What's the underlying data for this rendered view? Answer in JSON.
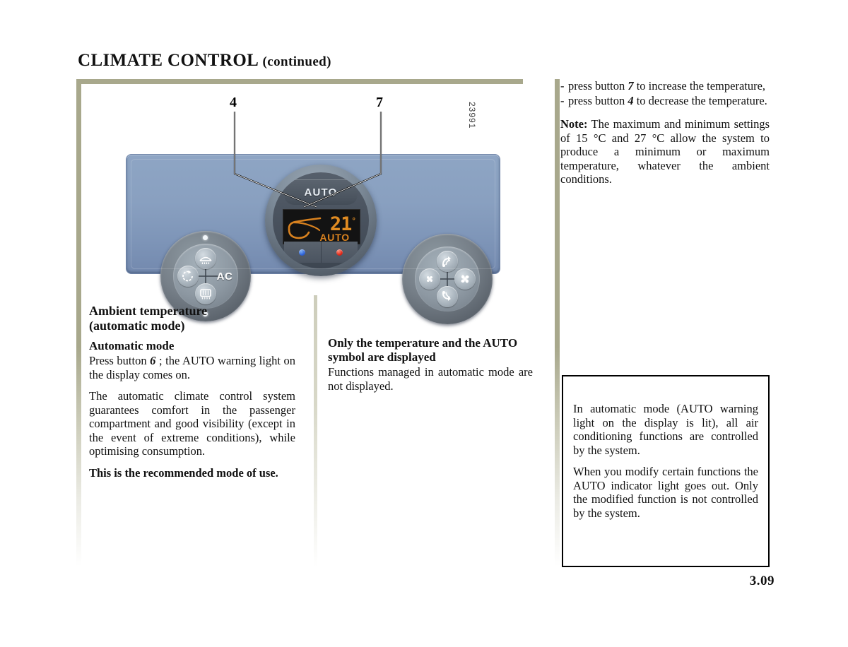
{
  "header": {
    "title_main": "CLIMATE CONTROL",
    "title_continued": "(continued)"
  },
  "figure": {
    "callout_left": "4",
    "callout_right": "7",
    "figure_code": "23991",
    "panel": {
      "auto_knob_label": "AUTO",
      "display": {
        "temperature": "21",
        "degree_symbol": "°",
        "mode_label": "AUTO",
        "car_icon": "car-silhouette-icon",
        "backlight_color": "#d9821f",
        "screen_color": "#131313"
      },
      "left_knob": {
        "top_button": "windscreen-defrost-icon",
        "left_button": "air-recirculation-icon",
        "right_button": "AC",
        "bottom_button": "rear-screen-defrost-icon"
      },
      "right_knob": {
        "top_button": "airflow-windscreen-icon",
        "left_button": "fan-low-icon",
        "right_button": "fan-high-icon",
        "bottom_button": "airflow-footwell-icon"
      },
      "centre_buttons": {
        "left_dot_color": "#2f63d8",
        "right_dot_color": "#e02718"
      },
      "panel_color": "#89a0c0"
    }
  },
  "columns": {
    "left": {
      "heading_line1": "Ambient temperature",
      "heading_line2": "(automatic mode)",
      "subheading": "Automatic mode",
      "para1_before": "Press button ",
      "para1_button": "6",
      "para1_after": " ; the AUTO warning light on the display comes on.",
      "para2": "The automatic climate control system guarantees comfort in the passenger compartment and good visibility (except in the event of extreme conditions), while optimising consumption.",
      "para3": "This is the recommended mode of use."
    },
    "middle": {
      "heading": "Only the temperature and the AUTO symbol are displayed",
      "para1": "Functions managed in automatic mode are not displayed."
    },
    "right": {
      "bullets": [
        {
          "before": "press button ",
          "ref": "7",
          "after": " to increase the temperature,"
        },
        {
          "before": "press button ",
          "ref": "4",
          "after": " to decrease the temperature."
        }
      ],
      "note_label": "Note:",
      "note_text": " The maximum and minimum settings of 15 °C and 27 °C allow the system to produce a minimum or maximum temperature, whatever the ambient conditions."
    }
  },
  "note_box": {
    "para1": "In automatic mode (AUTO warning light on the display is lit), all air conditioning functions are controlled by the system.",
    "para2": "When you modify certain functions the AUTO indicator light goes out. Only the modified function is not controlled by the system."
  },
  "footer": {
    "page_number": "3.09"
  },
  "theme": {
    "frame_color": "#a8a88c",
    "text_color": "#111111",
    "page_background": "#ffffff"
  }
}
